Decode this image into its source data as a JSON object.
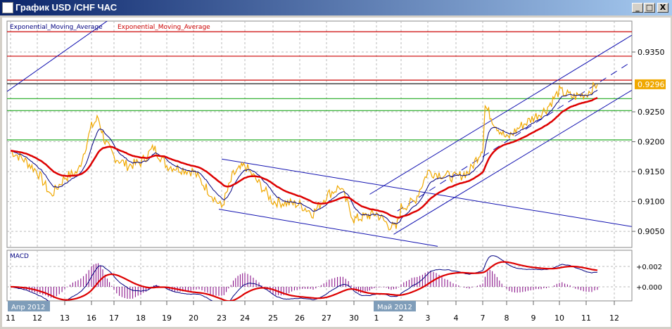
{
  "window": {
    "title": "График USD /CHF  ЧАС",
    "minimize_label": "_",
    "maximize_label": "□",
    "close_label": "X"
  },
  "legend": [
    {
      "label": "Exponential_Moving_Average",
      "color": "#000080"
    },
    {
      "label": "Exponential_Moving_Average",
      "color": "#cc0000"
    }
  ],
  "chart_data": [
    {
      "type": "line",
      "symbol": "USD/CHF",
      "timeframe": "ЧАС",
      "x_tick_labels": [
        "11",
        "12",
        "13",
        "16",
        "17",
        "18",
        "19",
        "20",
        "23",
        "24",
        "25",
        "26",
        "27",
        "30",
        "1",
        "2",
        "3",
        "4",
        "7",
        "8",
        "9",
        "10",
        "11",
        "12"
      ],
      "month_labels": [
        {
          "label": "Апр 2012",
          "at_tick": 0
        },
        {
          "label": "Май 2012",
          "at_tick": 14
        }
      ],
      "y_tick_labels": [
        "0.9350",
        "0.9250",
        "0.9200",
        "0.9150",
        "0.9100",
        "0.9050"
      ],
      "y_ticks": [
        0.935,
        0.925,
        0.92,
        0.915,
        0.91,
        0.905
      ],
      "ylim": [
        0.9016,
        0.9391
      ],
      "current_price": {
        "label": "0.9296",
        "value": 0.9296,
        "color": "#f0a800"
      },
      "price_color": "#f0a800",
      "price_keypoints": [
        [
          0,
          0.9185
        ],
        [
          0.5,
          0.917
        ],
        [
          1,
          0.915
        ],
        [
          1.5,
          0.911
        ],
        [
          2,
          0.914
        ],
        [
          2.5,
          0.915
        ],
        [
          3,
          0.9225
        ],
        [
          3.3,
          0.924
        ],
        [
          3.6,
          0.92
        ],
        [
          4,
          0.9175
        ],
        [
          4.5,
          0.916
        ],
        [
          5,
          0.9165
        ],
        [
          5.5,
          0.919
        ],
        [
          6,
          0.916
        ],
        [
          7,
          0.915
        ],
        [
          7.5,
          0.912
        ],
        [
          8,
          0.909
        ],
        [
          8.5,
          0.9145
        ],
        [
          9,
          0.916
        ],
        [
          9.5,
          0.913
        ],
        [
          10,
          0.91
        ],
        [
          11,
          0.9095
        ],
        [
          11.5,
          0.908
        ],
        [
          12,
          0.911
        ],
        [
          12.5,
          0.9125
        ],
        [
          13,
          0.907
        ],
        [
          13.5,
          0.9075
        ],
        [
          14,
          0.908
        ],
        [
          14.5,
          0.906
        ],
        [
          14.8,
          0.9055
        ],
        [
          15,
          0.909
        ],
        [
          15.5,
          0.91
        ],
        [
          16,
          0.915
        ],
        [
          16.5,
          0.9145
        ],
        [
          17,
          0.914
        ],
        [
          17.5,
          0.915
        ],
        [
          18,
          0.919
        ],
        [
          18.1,
          0.926
        ],
        [
          18.5,
          0.923
        ],
        [
          19,
          0.9205
        ],
        [
          19.5,
          0.9225
        ],
        [
          20,
          0.924
        ],
        [
          20.5,
          0.9255
        ],
        [
          21,
          0.9285
        ],
        [
          21.5,
          0.9275
        ],
        [
          22,
          0.928
        ],
        [
          22.4,
          0.9296
        ]
      ],
      "ema_fast_period_hint": "blue",
      "ema_slow_period_hint": "red",
      "levels": [
        {
          "value": 0.9384,
          "color": "#cc0000"
        },
        {
          "value": 0.9343,
          "color": "#cc0000"
        },
        {
          "value": 0.9303,
          "color": "#cc0000"
        },
        {
          "value": 0.9297,
          "color": "#000000"
        },
        {
          "value": 0.9272,
          "color": "#22aa22"
        },
        {
          "value": 0.9252,
          "color": "#22aa22"
        },
        {
          "value": 0.9203,
          "color": "#22aa22"
        }
      ],
      "trendlines": [
        {
          "from": [
            -0.13,
            0.9284
          ],
          "to": [
            3.7,
            0.9402
          ],
          "style": "solid"
        },
        {
          "from": [
            8,
            0.9171
          ],
          "to": [
            23.65,
            0.9058
          ],
          "style": "solid"
        },
        {
          "from": [
            7.9,
            0.9087
          ],
          "to": [
            16.35,
            0.9025
          ],
          "style": "solid"
        },
        {
          "from": [
            13.7,
            0.9112
          ],
          "to": [
            23.65,
            0.9378
          ],
          "style": "solid"
        },
        {
          "from": [
            14.85,
            0.9084
          ],
          "to": [
            23.65,
            0.9334
          ],
          "style": "dashed"
        },
        {
          "from": [
            14.7,
            0.9045
          ],
          "to": [
            23.65,
            0.9286
          ],
          "style": "solid"
        }
      ]
    },
    {
      "type": "line",
      "title": "MACD",
      "y_tick_labels": [
        "+0.002",
        "+0.000"
      ],
      "y_ticks": [
        0.002,
        0.0
      ],
      "series_colors": {
        "macd": "#000080",
        "signal": "#dd0000",
        "histogram": "#800080"
      }
    }
  ]
}
